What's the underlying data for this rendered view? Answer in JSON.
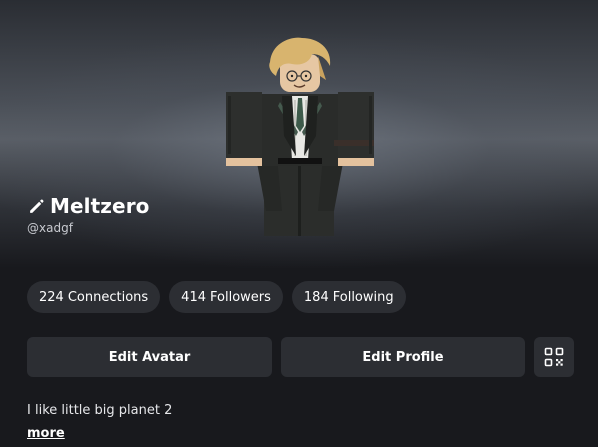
{
  "profile": {
    "display_name": "Meltzero",
    "handle": "@xadgf",
    "bio": "I like little big planet 2",
    "more_label": "more"
  },
  "stats": [
    {
      "count": "224",
      "label": "Connections"
    },
    {
      "count": "414",
      "label": "Followers"
    },
    {
      "count": "184",
      "label": "Following"
    }
  ],
  "actions": {
    "edit_avatar": "Edit Avatar",
    "edit_profile": "Edit Profile"
  },
  "icons": {
    "edit_name": "pencil-icon",
    "qr": "qr-code-icon"
  },
  "colors": {
    "background": "#18191d",
    "pill_background": "#2c2e33",
    "text": "#ffffff",
    "handle_text": "#c8cad0"
  }
}
